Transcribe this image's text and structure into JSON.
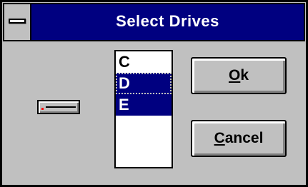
{
  "window": {
    "title": "Select Drives"
  },
  "drive_list": {
    "items": [
      {
        "label": "C",
        "selected": false
      },
      {
        "label": "D",
        "selected": true,
        "focused": true
      },
      {
        "label": "E",
        "selected": true
      }
    ]
  },
  "buttons": {
    "ok": {
      "mnemonic": "O",
      "rest": "k"
    },
    "cancel": {
      "mnemonic": "C",
      "rest": "ancel"
    }
  },
  "icons": {
    "system_menu": "system-menu-icon",
    "drive": "disk-drive-icon"
  },
  "colors": {
    "titlebar": "#000080",
    "face": "#c0c0c0",
    "selection": "#000080",
    "drive_led": "#ff0000"
  }
}
